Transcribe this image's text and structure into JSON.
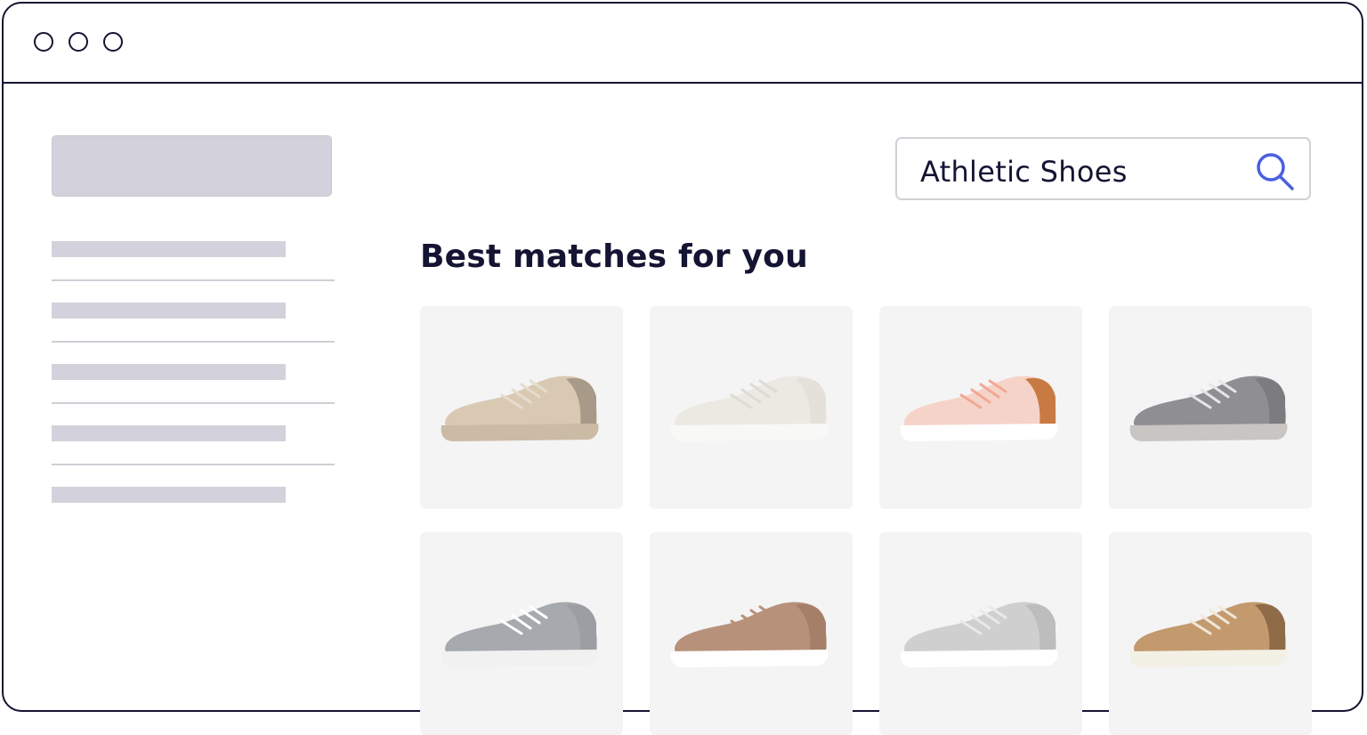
{
  "search": {
    "value": "Athletic Shoes",
    "icon": "search-icon"
  },
  "main": {
    "heading": "Best matches for you"
  },
  "colors": {
    "accent": "#4a5fe0",
    "text": "#141433",
    "placeholder": "#d3d2dc",
    "card": "#f4f4f5"
  },
  "products": [
    {
      "name": "beige-knit-sneaker",
      "upper": "#d9c9b3",
      "sole": "#cbbba5",
      "heel": "#a89a88",
      "lace": "#e6dccd"
    },
    {
      "name": "white-canvas-sneaker",
      "upper": "#ece9e3",
      "sole": "#f8f8f6",
      "heel": "#e4e1da",
      "lace": "#dedbd5"
    },
    {
      "name": "pink-running-shoe",
      "upper": "#f6d3c8",
      "sole": "#ffffff",
      "heel": "#c87a43",
      "lace": "#f2a894"
    },
    {
      "name": "grey-knit-runner",
      "upper": "#8e8e93",
      "sole": "#c8c5c2",
      "heel": "#7c7c80",
      "lace": "#e6e6e8"
    },
    {
      "name": "grey-mesh-sneaker",
      "upper": "#a6a9ad",
      "sole": "#f1f1f1",
      "heel": "#9b9ea2",
      "lace": "#ffffff"
    },
    {
      "name": "tan-slip-on",
      "upper": "#b8917a",
      "sole": "#ffffff",
      "heel": "#a67f69",
      "lace": "#b8917a"
    },
    {
      "name": "light-grey-runner",
      "upper": "#cfcfd0",
      "sole": "#ffffff",
      "heel": "#bdbdbe",
      "lace": "#e9e9ea"
    },
    {
      "name": "brown-leather-sneaker",
      "upper": "#c39a6e",
      "sole": "#f3f0e6",
      "heel": "#8f6b48",
      "lace": "#f0e7d8"
    }
  ]
}
